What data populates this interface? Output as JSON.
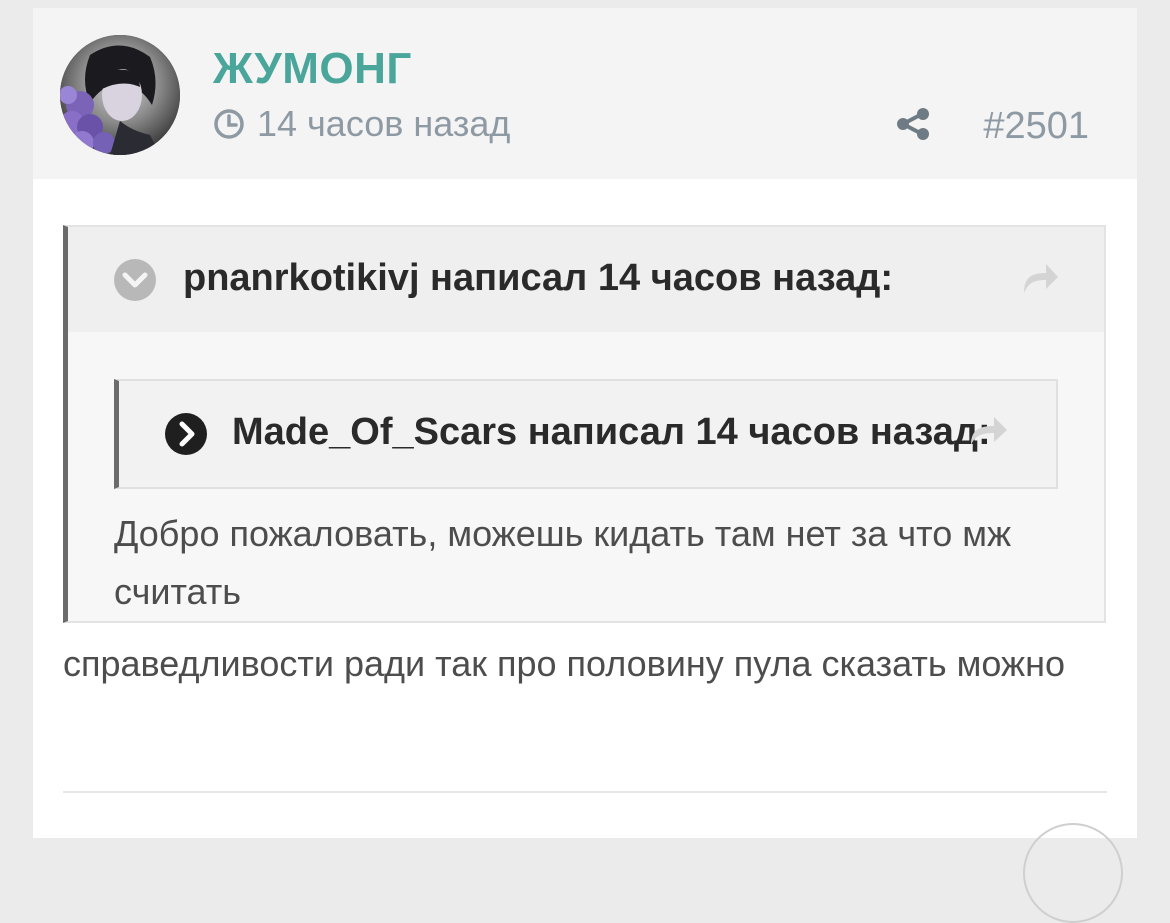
{
  "post": {
    "author": "ЖУМОНГ",
    "time": "14 часов назад",
    "number": "#2501",
    "icons": {
      "clock": "clock-icon",
      "share": "share-icon",
      "avatar": "avatar"
    }
  },
  "quote": {
    "title": "pnanrkotikivj написал 14 часов назад:",
    "nested": {
      "title": "Made_Of_Scars написал 14 часов назад:"
    },
    "text": "Добро пожаловать, можешь кидать там нет за что мж считать"
  },
  "body": {
    "text": "справедливости ради так про половину пула сказать можно"
  },
  "colors": {
    "author": "#4aa59b",
    "meta": "#8e9aa3",
    "text": "#4d4d4d",
    "quote_border": "#6b6b6b"
  }
}
